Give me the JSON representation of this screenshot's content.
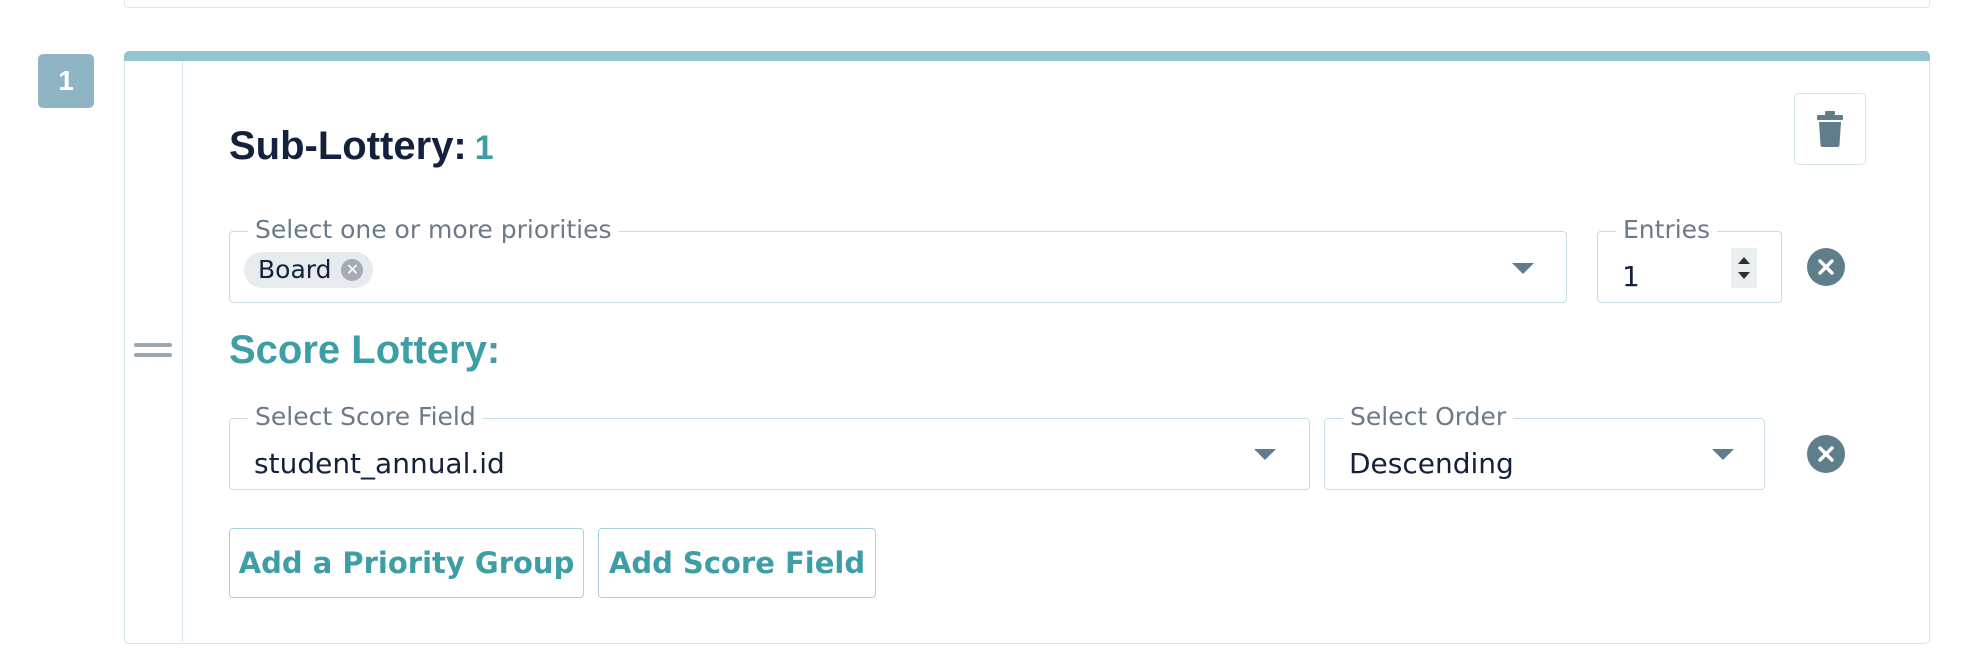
{
  "sub_lottery": {
    "index_badge": "1",
    "title_label": "Sub-Lottery:",
    "title_number": "1"
  },
  "priorities": {
    "label": "Select one or more priorities",
    "chips": [
      "Board"
    ]
  },
  "entries": {
    "label": "Entries",
    "value": "1"
  },
  "score_lottery": {
    "title": "Score Lottery:",
    "score_field_label": "Select Score Field",
    "score_field_value": "student_annual.id",
    "order_label": "Select Order",
    "order_value": "Descending"
  },
  "actions": {
    "add_priority_group": "Add a Priority Group",
    "add_score_field": "Add Score Field"
  },
  "icons": {
    "delete": "trash-icon",
    "remove": "close-circle-icon",
    "dropdown": "caret-down-icon",
    "drag": "drag-handle-icon"
  },
  "colors": {
    "accent": "#3d9ea6",
    "card_top_bar": "#92c5d0",
    "index_badge": "#8fb5c5",
    "remove_icon": "#607d8b",
    "heading": "#14213d"
  }
}
